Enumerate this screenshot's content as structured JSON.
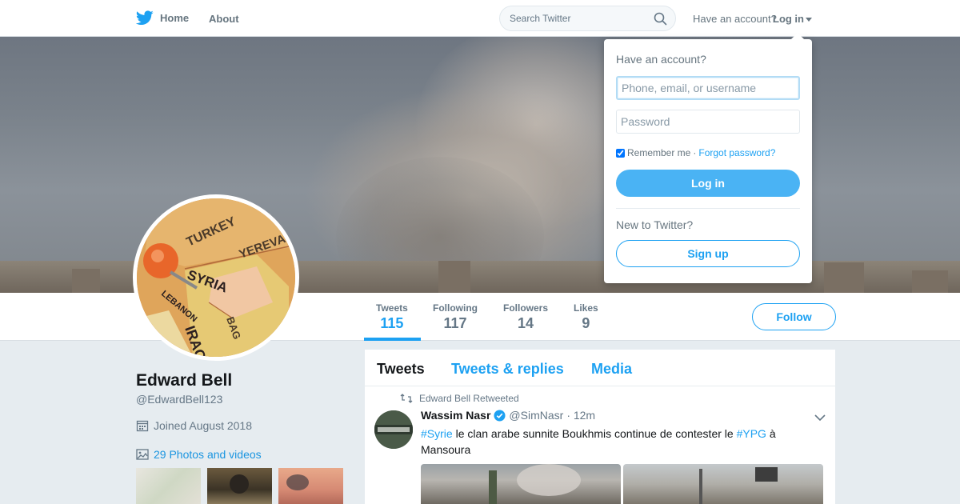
{
  "nav": {
    "home_label": "Home",
    "about_label": "About",
    "search_placeholder": "Search Twitter",
    "have_account": "Have an account?",
    "login_label": "Log in"
  },
  "profile": {
    "name": "Edward Bell",
    "handle": "@EdwardBell123",
    "joined": "Joined August 2018",
    "photos_link": "29 Photos and videos",
    "avatar_map_labels": [
      "TURKEY",
      "YEREVAN",
      "SYRIA",
      "LEBANON",
      "IRAQ",
      "BAG"
    ]
  },
  "stats": [
    {
      "label": "Tweets",
      "value": "115"
    },
    {
      "label": "Following",
      "value": "117"
    },
    {
      "label": "Followers",
      "value": "14"
    },
    {
      "label": "Likes",
      "value": "9"
    }
  ],
  "follow_label": "Follow",
  "tabs": [
    "Tweets",
    "Tweets & replies",
    "Media"
  ],
  "tweet": {
    "retweeted_by": "Edward Bell Retweeted",
    "author": "Wassim Nasr",
    "handle": "@SimNasr",
    "time": "· 12m",
    "hashtag1": "#Syrie",
    "text1": " le clan arabe sunnite Boukhmis continue de contester le ",
    "hashtag2": "#YPG",
    "text2": " à Mansoura"
  },
  "login_dropdown": {
    "title": "Have an account?",
    "username_placeholder": "Phone, email, or username",
    "password_placeholder": "Password",
    "remember": "Remember me",
    "separator": " · ",
    "forgot": "Forgot password?",
    "login_button": "Log in",
    "new_to": "New to Twitter?",
    "signup_button": "Sign up"
  },
  "colors": {
    "accent": "#1da1f2",
    "login_button": "#4ab3f4",
    "verified": "#1da1f2"
  }
}
